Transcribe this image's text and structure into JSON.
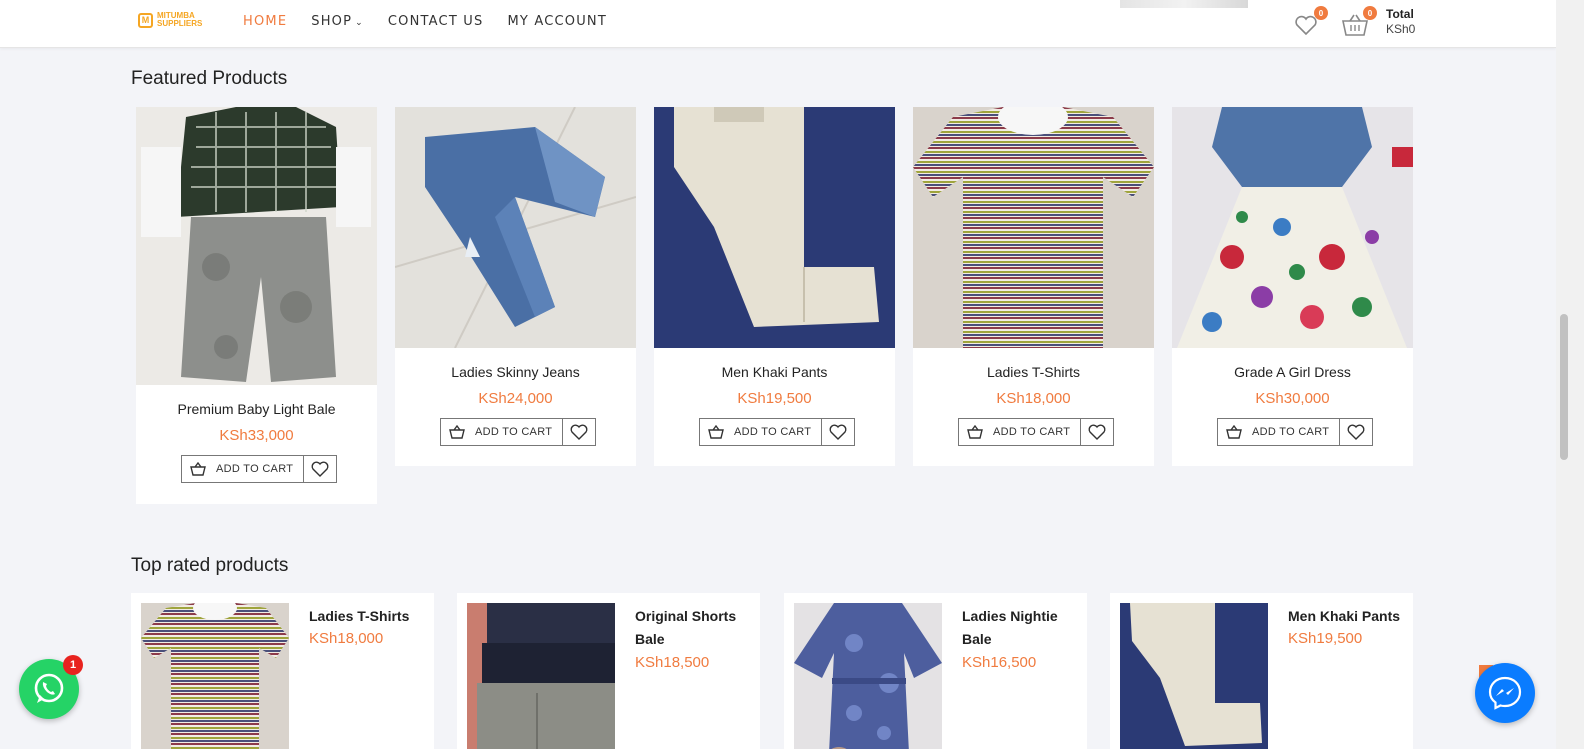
{
  "header": {
    "logo_line1": "MITUMBA",
    "logo_line2": "SUPPLIERS",
    "logo_mark": "M",
    "nav": [
      {
        "label": "HOME"
      },
      {
        "label": "SHOP"
      },
      {
        "label": "CONTACT US"
      },
      {
        "label": "MY ACCOUNT"
      }
    ],
    "wishlist_count": "0",
    "cart_count": "0",
    "total_label": "Total",
    "total_value": "KSh0"
  },
  "featured": {
    "title": "Featured Products",
    "add_to_cart_label": "ADD TO CART",
    "products": [
      {
        "name": "Premium Baby Light Bale",
        "price": "KSh33,000"
      },
      {
        "name": "Ladies Skinny Jeans",
        "price": "KSh24,000"
      },
      {
        "name": "Men Khaki Pants",
        "price": "KSh19,500"
      },
      {
        "name": "Ladies T-Shirts",
        "price": "KSh18,000"
      },
      {
        "name": "Grade A Girl Dress",
        "price": "KSh30,000"
      }
    ]
  },
  "top_rated": {
    "title": "Top rated products",
    "products": [
      {
        "name": "Ladies T-Shirts",
        "price": "KSh18,000"
      },
      {
        "name": "Original Shorts Bale",
        "price": "KSh18,500"
      },
      {
        "name": "Ladies Nightie Bale",
        "price": "KSh16,500"
      },
      {
        "name": "Men Khaki Pants",
        "price": "KSh19,500"
      }
    ]
  },
  "whatsapp_badge": "1",
  "colors": {
    "accent": "#f07b3f",
    "logo": "#f5a623",
    "whatsapp": "#25d366",
    "messenger": "#0a7cff"
  }
}
